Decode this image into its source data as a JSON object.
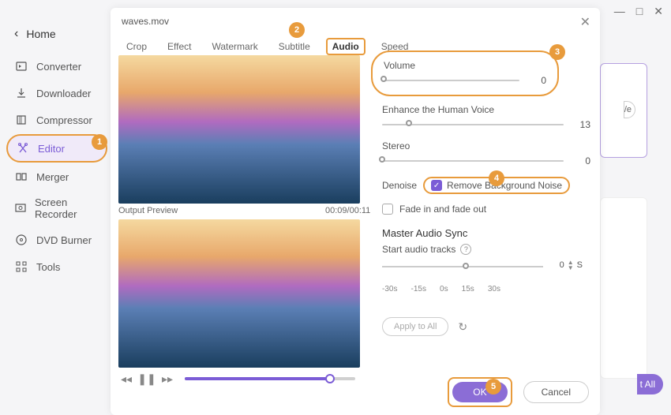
{
  "topbar": {
    "min": "—",
    "max": "□",
    "close": "✕"
  },
  "sidebar": {
    "home": "Home",
    "items": [
      {
        "label": "Converter"
      },
      {
        "label": "Downloader"
      },
      {
        "label": "Compressor"
      },
      {
        "label": "Editor"
      },
      {
        "label": "Merger"
      },
      {
        "label": "Screen Recorder"
      },
      {
        "label": "DVD Burner"
      },
      {
        "label": "Tools"
      }
    ]
  },
  "dialog": {
    "title": "waves.mov",
    "close": "✕"
  },
  "tabs": [
    "Crop",
    "Effect",
    "Watermark",
    "Subtitle",
    "Audio",
    "Speed"
  ],
  "preview": {
    "label": "Output Preview",
    "time": "00:09/00:11"
  },
  "panel": {
    "volume_label": "Volume",
    "volume_value": "0",
    "enhance_label": "Enhance the Human Voice",
    "enhance_value": "13",
    "stereo_label": "Stereo",
    "stereo_value": "0",
    "denoise_label": "Denoise",
    "remove_bg": "Remove Background Noise",
    "fade_label": "Fade in and fade out",
    "sync_title": "Master Audio Sync",
    "sync_sub": "Start audio tracks",
    "sync_min30": "-30s",
    "sync_min15": "-15s",
    "sync_0": "0s",
    "sync_15": "15s",
    "sync_30": "30s",
    "sync_val": "0",
    "sync_unit": "S",
    "apply": "Apply to All"
  },
  "footer": {
    "ok": "OK",
    "cancel": "Cancel"
  },
  "bg": {
    "all": "t All",
    "save": "/e"
  },
  "badges": {
    "b1": "1",
    "b2": "2",
    "b3": "3",
    "b4": "4",
    "b5": "5"
  }
}
